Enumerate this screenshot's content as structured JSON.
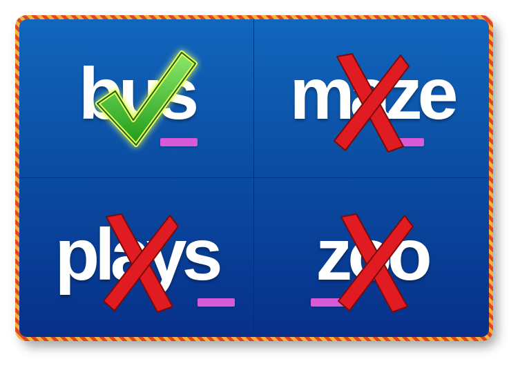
{
  "tiles": [
    {
      "word": "bus",
      "highlight_letter": "s",
      "result": "correct",
      "result_icon": "check-mark-icon"
    },
    {
      "word": "maze",
      "highlight_letter": "z",
      "result": "incorrect",
      "result_icon": "x-mark-icon"
    },
    {
      "word": "plays",
      "highlight_letter": "s",
      "result": "incorrect",
      "result_icon": "x-mark-icon"
    },
    {
      "word": "zoo",
      "highlight_letter": "z",
      "result": "incorrect",
      "result_icon": "x-mark-icon"
    }
  ],
  "colors": {
    "board_top": "#1166bd",
    "board_bottom": "#07308a",
    "border_stripe_a": "#e0452a",
    "border_stripe_b": "#f3b23a",
    "underline": "#d75bd8",
    "check": "#3fbf2a",
    "cross": "#e01b22"
  }
}
